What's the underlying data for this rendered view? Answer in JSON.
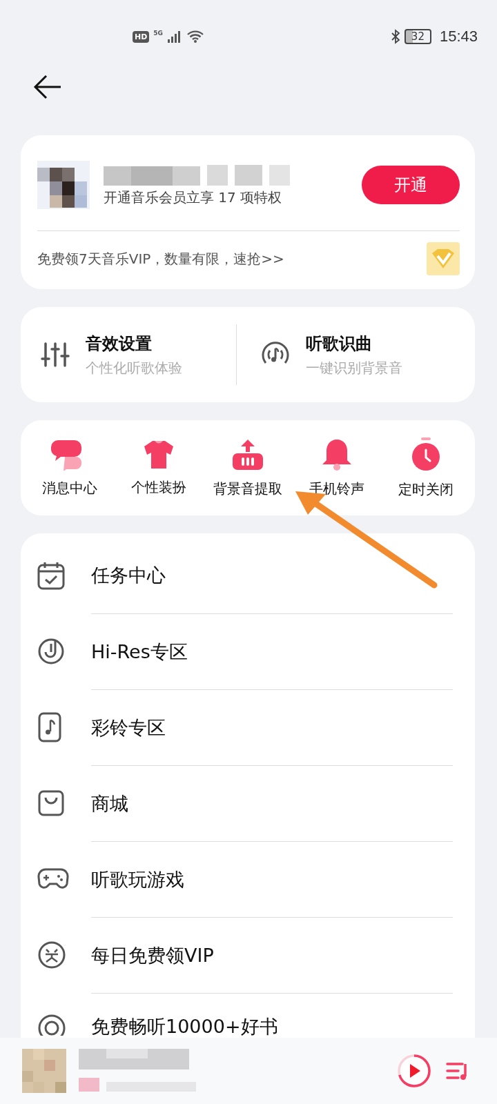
{
  "status_bar": {
    "time": "15:43",
    "battery": "32",
    "network": "5G",
    "hd": "HD"
  },
  "member_card": {
    "subtitle": "开通音乐会员立享 17 项特权",
    "button": "开通",
    "promo": "免费领7天音乐VIP，数量有限，速抢>>"
  },
  "features": [
    {
      "kind": "equalizer",
      "title": "音效设置",
      "subtitle": "个性化听歌体验"
    },
    {
      "kind": "recognize",
      "title": "听歌识曲",
      "subtitle": "一键识别背景音"
    }
  ],
  "shortcuts": [
    {
      "kind": "message",
      "label": "消息中心"
    },
    {
      "kind": "shirt",
      "label": "个性装扮"
    },
    {
      "kind": "extract",
      "label": "背景音提取"
    },
    {
      "kind": "bell",
      "label": "手机铃声"
    },
    {
      "kind": "timer",
      "label": "定时关闭"
    }
  ],
  "menu": [
    {
      "kind": "task",
      "label": "任务中心"
    },
    {
      "kind": "hires",
      "label": "Hi-Res专区"
    },
    {
      "kind": "ringtone",
      "label": "彩铃专区"
    },
    {
      "kind": "shop",
      "label": "商城"
    },
    {
      "kind": "game",
      "label": "听歌玩游戏"
    },
    {
      "kind": "prize",
      "label": "每日免费领VIP"
    },
    {
      "kind": "book",
      "label": "免费畅听10000+好书"
    }
  ]
}
